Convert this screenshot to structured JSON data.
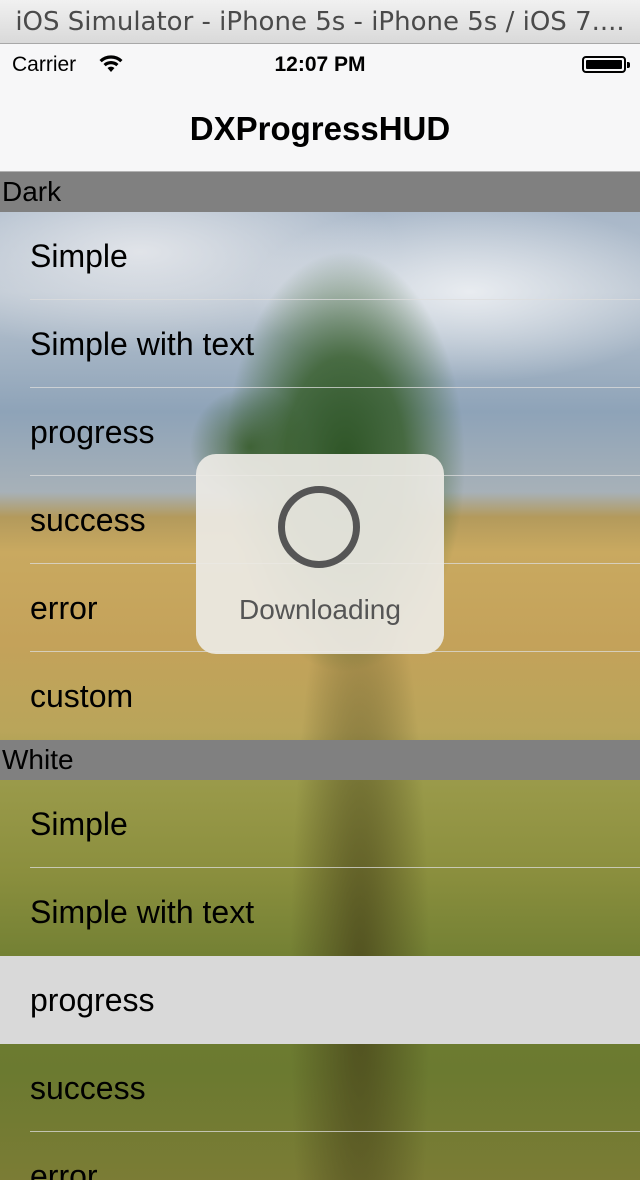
{
  "simulator": {
    "window_title": "iOS Simulator - iPhone 5s - iPhone 5s / iOS 7...."
  },
  "status_bar": {
    "carrier": "Carrier",
    "time": "12:07 PM"
  },
  "nav": {
    "title": "DXProgressHUD"
  },
  "sections": [
    {
      "header": "Dark",
      "rows": [
        "Simple",
        "Simple with text",
        "progress",
        "success",
        "error",
        "custom"
      ]
    },
    {
      "header": "White",
      "rows": [
        "Simple",
        "Simple with text",
        "progress",
        "success",
        "error"
      ]
    }
  ],
  "hud": {
    "label": "Downloading"
  },
  "icons": {
    "wifi": "wifi-icon",
    "battery": "battery-icon",
    "spinner": "progress-ring-icon"
  }
}
